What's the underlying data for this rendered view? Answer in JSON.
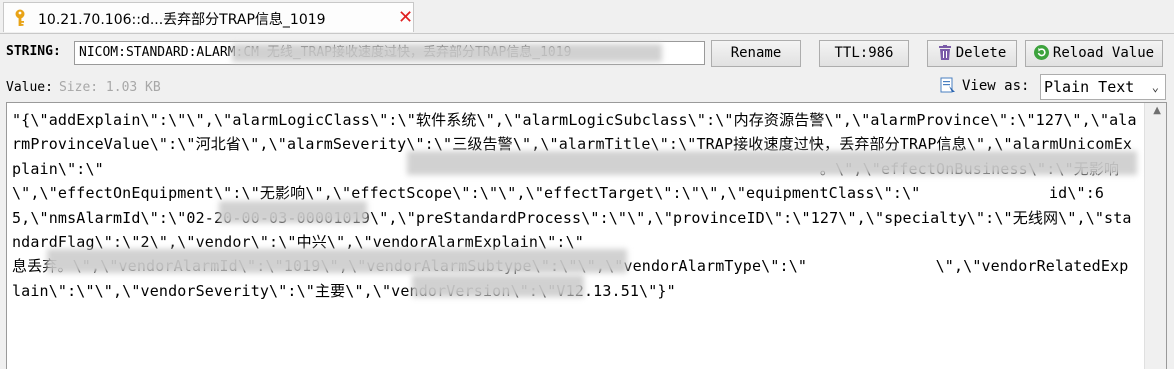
{
  "tab": {
    "title": "10.21.70.106::d...丢弃部分TRAP信息_1019",
    "close_symbol": "✕"
  },
  "key_row": {
    "type_label": "STRING:",
    "key_value": "NICOM:STANDARD:ALARM:CM  无线_TRAP接收速度过快，丢弃部分TRAP信息_1019",
    "buttons": {
      "rename": "Rename",
      "ttl": "TTL:986",
      "delete": "Delete",
      "reload": "Reload Value"
    }
  },
  "value_row": {
    "label": "Value:",
    "size": "Size: 1.03 KB",
    "view_as_label": "View as:",
    "view_as_selected": "Plain Text"
  },
  "value_text": "\"{\\\"addExplain\\\":\\\"\\\",\\\"alarmLogicClass\\\":\\\"软件系统\\\",\\\"alarmLogicSubclass\\\":\\\"内存资源告警\\\",\\\"alarmProvince\\\":\\\"127\\\",\\\"alarmProvinceValue\\\":\\\"河北省\\\",\\\"alarmSeverity\\\":\\\"三级告警\\\",\\\"alarmTitle\\\":\\\"TRAP接收速度过快，丢弃部分TRAP信息\\\",\\\"alarmUnicomExplain\\\":\\\"                                                                              。\\\",\\\"effectOnBusiness\\\":\\\"无影响\\\",\\\"effectOnEquipment\\\":\\\"无影响\\\",\\\"effectScope\\\":\\\"\\\",\\\"effectTarget\\\":\\\"\\\",\\\"equipmentClass\\\":\\\"              id\\\":65,\\\"nmsAlarmId\\\":\\\"02-20-00-03-00001019\\\",\\\"preStandardProcess\\\":\\\"\\\",\\\"provinceID\\\":\\\"127\\\",\\\"specialty\\\":\\\"无线网\\\",\\\"standardFlag\\\":\\\"2\\\",\\\"vendor\\\":\\\"中兴\\\",\\\"vendorAlarmExplain\\\":\\\"                                                                      息丢弃。\\\",\\\"vendorAlarmId\\\":\\\"1019\\\",\\\"vendorAlarmSubtype\\\":\\\"\\\",\\\"vendorAlarmType\\\":\\\"              \\\",\\\"vendorRelatedExplain\\\":\\\"\\\",\\\"vendorSeverity\\\":\\\"主要\\\",\\\"vendorVersion\\\":\\\"V12.13.51\\\"}\"",
  "colors": {
    "close": "#e02020",
    "key_icon": "#e8a317",
    "delete_icon": "#7a5aa8",
    "reload_icon": "#3da33d",
    "size_text": "#a8a8a8"
  },
  "icons": {
    "tab": "key-icon",
    "close": "close-icon",
    "delete": "trash-icon",
    "reload": "refresh-icon",
    "view_as": "format-icon"
  }
}
